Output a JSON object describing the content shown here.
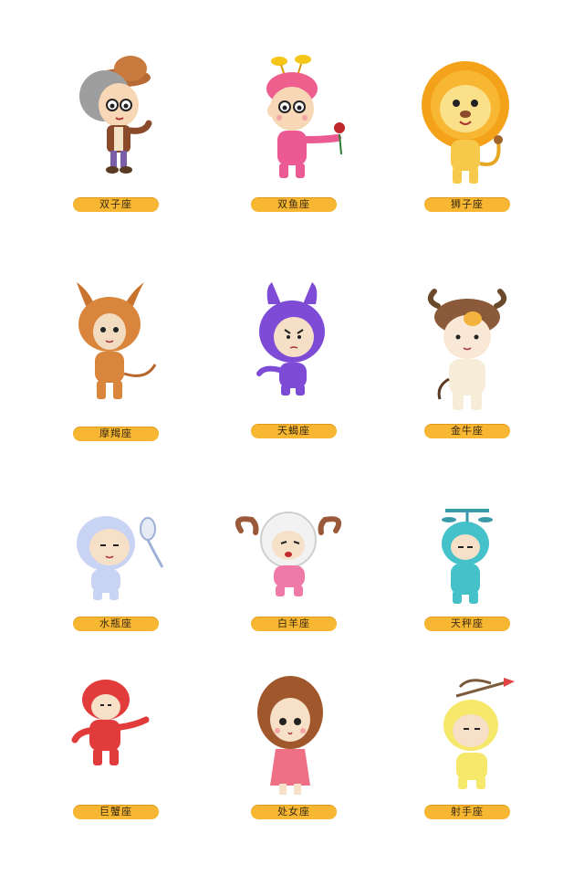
{
  "signs": [
    {
      "label": "双子座"
    },
    {
      "label": "双鱼座"
    },
    {
      "label": "狮子座"
    },
    {
      "label": "摩羯座"
    },
    {
      "label": "天蝎座"
    },
    {
      "label": "金牛座"
    },
    {
      "label": "水瓶座"
    },
    {
      "label": "白羊座"
    },
    {
      "label": "天秤座"
    },
    {
      "label": "巨蟹座"
    },
    {
      "label": "处女座"
    },
    {
      "label": "射手座"
    }
  ]
}
